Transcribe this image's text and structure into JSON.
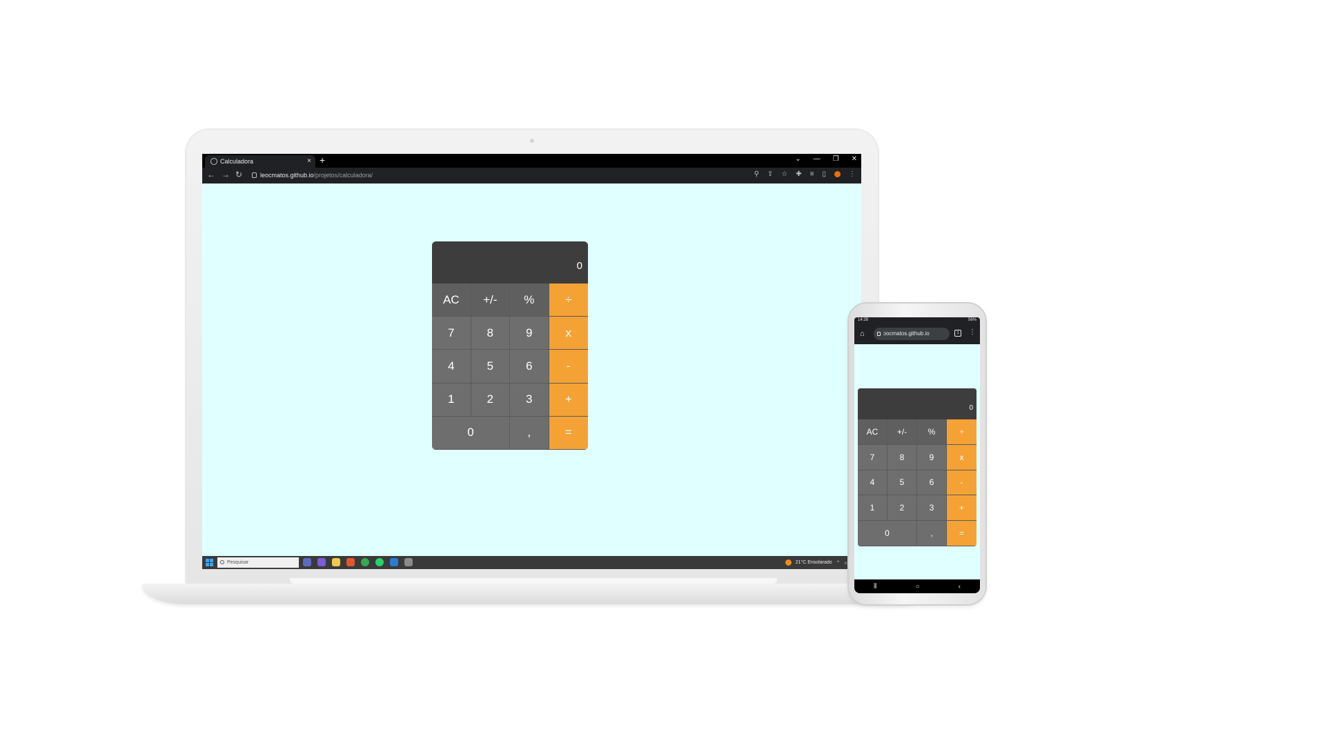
{
  "browser": {
    "tab_title": "Calculadora",
    "tab_close": "×",
    "new_tab": "+",
    "url_host": "leocmatos.github.io",
    "url_path": "/projetos/calculadora/",
    "window_controls": [
      "⌄",
      "—",
      "❐",
      "✕"
    ]
  },
  "calculator": {
    "display": "0",
    "keys": [
      {
        "label": "AC",
        "kind": "fn"
      },
      {
        "label": "+/-",
        "kind": "fn"
      },
      {
        "label": "%",
        "kind": "fn"
      },
      {
        "label": "÷",
        "kind": "op"
      },
      {
        "label": "7",
        "kind": "num"
      },
      {
        "label": "8",
        "kind": "num"
      },
      {
        "label": "9",
        "kind": "num"
      },
      {
        "label": "x",
        "kind": "op"
      },
      {
        "label": "4",
        "kind": "num"
      },
      {
        "label": "5",
        "kind": "num"
      },
      {
        "label": "6",
        "kind": "num"
      },
      {
        "label": "-",
        "kind": "op"
      },
      {
        "label": "1",
        "kind": "num"
      },
      {
        "label": "2",
        "kind": "num"
      },
      {
        "label": "3",
        "kind": "num"
      },
      {
        "label": "+",
        "kind": "op"
      },
      {
        "label": "0",
        "kind": "zero"
      },
      {
        "label": ",",
        "kind": "num"
      },
      {
        "label": "=",
        "kind": "op"
      }
    ],
    "colors": {
      "body": "#3d3d3d",
      "key": "#6e6e6e",
      "operator": "#f4a235"
    }
  },
  "page": {
    "background": "#e0ffff"
  },
  "taskbar": {
    "search_placeholder": "Pesquisar",
    "weather": "21°C  Ensolarado"
  },
  "phone": {
    "time": "14:28",
    "battery": "56%",
    "url": "ɔocmatos.github.io",
    "tab_count": "1"
  }
}
